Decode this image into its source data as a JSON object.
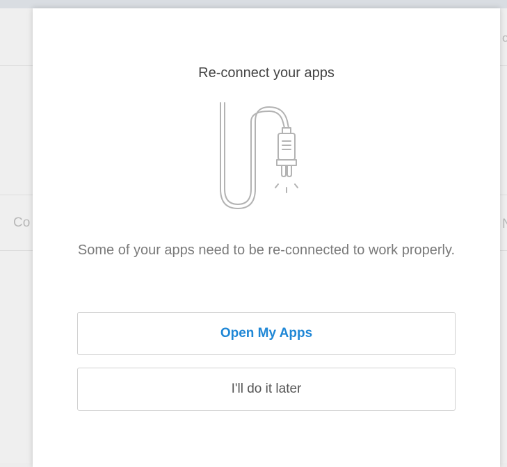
{
  "background": {
    "left_fragment": "Co",
    "right_fragment_top": "o",
    "right_fragment_mid": "N"
  },
  "modal": {
    "title": "Re-connect your apps",
    "illustration": "unplugged-cable-icon",
    "message": "Some of your apps need to be re-connected to work properly.",
    "primary_button_label": "Open My Apps",
    "secondary_button_label": "I'll do it later"
  },
  "colors": {
    "primary_text": "#1f87d6",
    "title_text": "#444444",
    "body_text": "#7a7a7a",
    "button_border": "#cfcfcf",
    "icon_stroke": "#b3b3b3"
  }
}
